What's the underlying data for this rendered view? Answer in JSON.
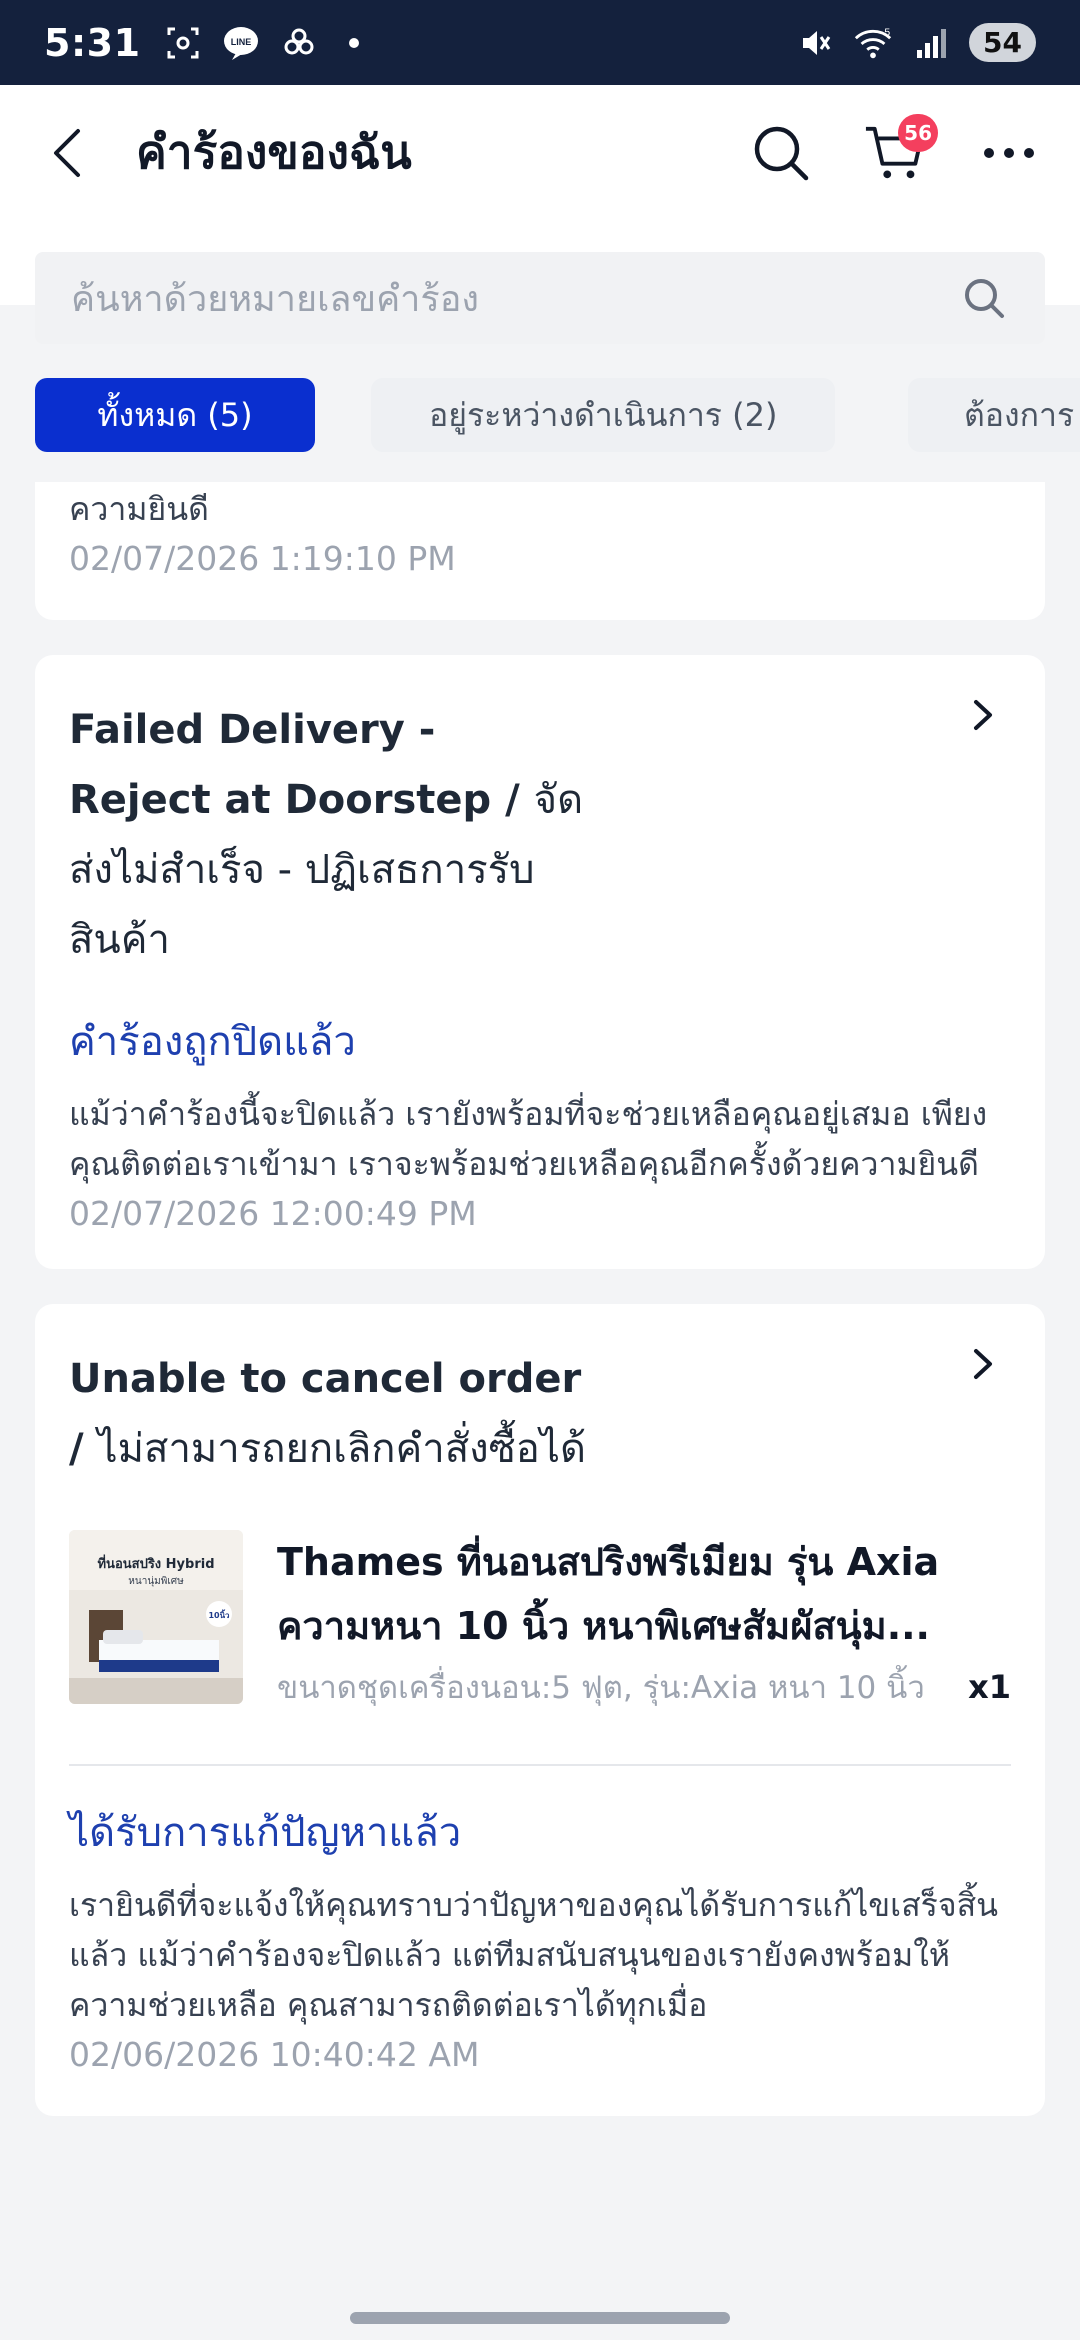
{
  "status_bar": {
    "time": "5:31",
    "battery": "54",
    "wifi_label": "5"
  },
  "header": {
    "title": "คำร้องของฉัน",
    "cart_count": "56"
  },
  "search": {
    "placeholder": "ค้นหาด้วยหมายเลขคำร้อง"
  },
  "tabs": [
    {
      "label": "ทั้งหมด (5)",
      "active": true
    },
    {
      "label": "อยู่ระหว่างดำเนินการ (2)",
      "active": false
    },
    {
      "label": "ต้องการ",
      "active": false
    }
  ],
  "tickets": [
    {
      "status_desc_tail": "ความยินดี",
      "timestamp": "02/07/2026 1:19:10 PM"
    },
    {
      "title_en": "Failed Delivery - Reject at Doorstep /",
      "title_th": "จัดส่งไม่สำเร็จ - ปฏิเสธการรับสินค้า",
      "status": "คำร้องถูกปิดแล้ว",
      "status_desc": "แม้ว่าคำร้องนี้จะปิดแล้ว เรายังพร้อมที่จะช่วยเหลือคุณอยู่เสมอ เพียงคุณติดต่อเราเข้ามา เราจะพร้อมช่วยเหลือคุณอีกครั้งด้วยความยินดี",
      "timestamp": "02/07/2026 12:00:49 PM"
    },
    {
      "title_en": "Unable to cancel order /",
      "title_th": "ไม่สามารถยกเลิกคำสั่งซื้อได้",
      "product": {
        "name": "Thames ที่นอนสปริงพรีเมียม รุ่น Axia ความหนา 10 นิ้ว หนาพิเศษสัมผัสนุ่ม...",
        "variant": "ขนาดชุดเครื่องนอน:5 ฟุต, รุ่น:Axia หนา 10 นิ้ว",
        "qty": "x1",
        "thumb_text": "ที่นอนสปริง Hybrid",
        "thumb_sub": "หนานุ่มพิเศษ",
        "thumb_badge": "10นิ้ว"
      },
      "status": "ได้รับการแก้ปัญหาแล้ว",
      "status_desc": "เรายินดีที่จะแจ้งให้คุณทราบว่าปัญหาของคุณได้รับการแก้ไขเสร็จสิ้นแล้ว แม้ว่าคำร้องจะปิดแล้ว แต่ทีมสนับสนุนของเรายังคงพร้อมให้ความช่วยเหลือ คุณสามารถติดต่อเราได้ทุกเมื่อ",
      "timestamp": "02/06/2026 10:40:42 AM"
    }
  ],
  "colors": {
    "status_bar": "#14213d",
    "accent": "#0a2fcf",
    "status_link": "#1e40af",
    "badge": "#f43f5e"
  }
}
